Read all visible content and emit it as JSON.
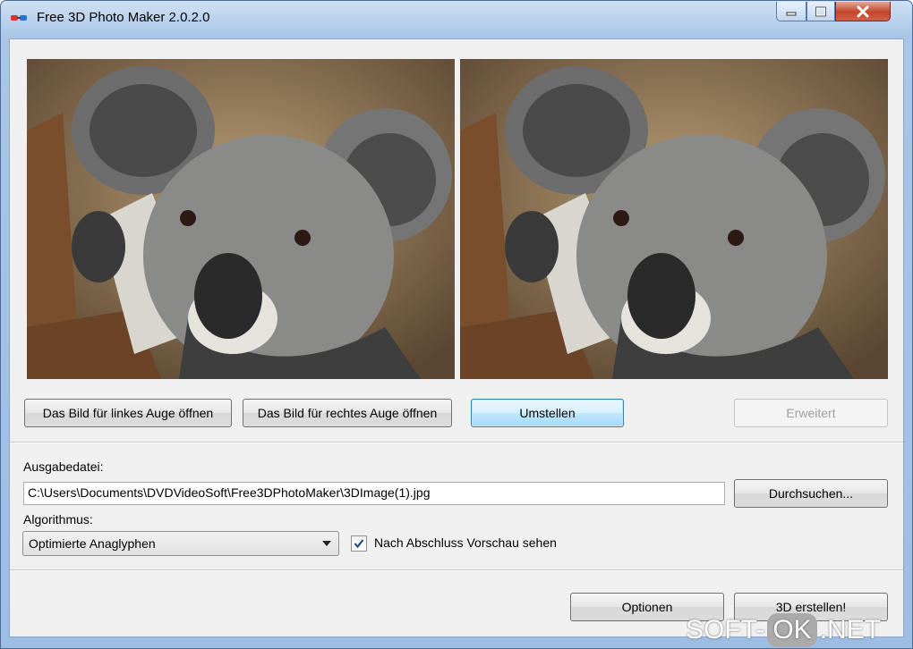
{
  "window": {
    "title": "Free 3D Photo Maker 2.0.2.0"
  },
  "previews": {
    "left_image": "koala-photo",
    "right_image": "koala-photo"
  },
  "buttons": {
    "open_left": "Das Bild für linkes Auge öffnen",
    "open_right": "Das Bild für rechtes Auge öffnen",
    "swap": "Umstellen",
    "advanced": "Erweitert",
    "browse": "Durchsuchen...",
    "options": "Optionen",
    "create": "3D erstellen!"
  },
  "output": {
    "label": "Ausgabedatei:",
    "path": "C:\\Users\\Documents\\DVDVideoSoft\\Free3DPhotoMaker\\3DImage(1).jpg"
  },
  "algorithm": {
    "label": "Algorithmus:",
    "selected": "Optimierte Anaglyphen"
  },
  "preview_check": {
    "label": "Nach Abschluss Vorschau sehen",
    "checked": true
  },
  "watermark": {
    "part1": "SOFT-",
    "part2": "OK",
    "part3": ".NET"
  },
  "colors": {
    "title_bar": "#a9c6e8",
    "close_button": "#c4452a",
    "default_button_border": "#3c7fb1"
  }
}
